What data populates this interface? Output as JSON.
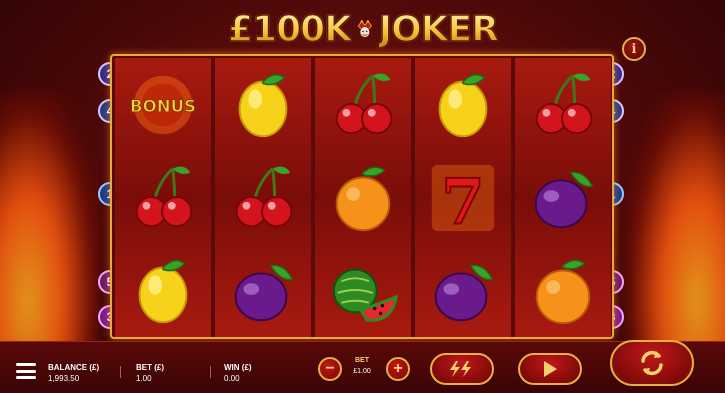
{
  "game": {
    "title_left": "£100K",
    "title_right": "JOKER",
    "info_label": "i"
  },
  "paylines_left": [
    "2",
    "4",
    "1",
    "5",
    "3"
  ],
  "paylines_right": [
    "2",
    "4",
    "1",
    "5",
    "3"
  ],
  "reels": [
    [
      "bonus",
      "cherries",
      "lemon"
    ],
    [
      "lemon",
      "cherries",
      "plum"
    ],
    [
      "cherries",
      "orange",
      "watermelon"
    ],
    [
      "lemon",
      "seven",
      "plum"
    ],
    [
      "cherries",
      "plum",
      "orange"
    ]
  ],
  "bonus_text": "BONUS",
  "seven_text": "7",
  "bottom_bar": {
    "balance_label": "BALANCE (£)",
    "balance_value": "1,993.50",
    "bet_label": "BET (£)",
    "bet_value": "1.00",
    "win_label": "WIN (£)",
    "win_value": "0.00",
    "bet_control_label": "BET",
    "bet_control_value": "£1.00",
    "minus_label": "−",
    "plus_label": "+"
  },
  "icons": {
    "menu": "menu-icon",
    "turbo": "lightning-icon",
    "play": "play-icon",
    "autoplay": "refresh-icon"
  },
  "colors": {
    "gold": "#e8b040",
    "button_red": "#c01818",
    "reel_red": "#a81a10"
  }
}
